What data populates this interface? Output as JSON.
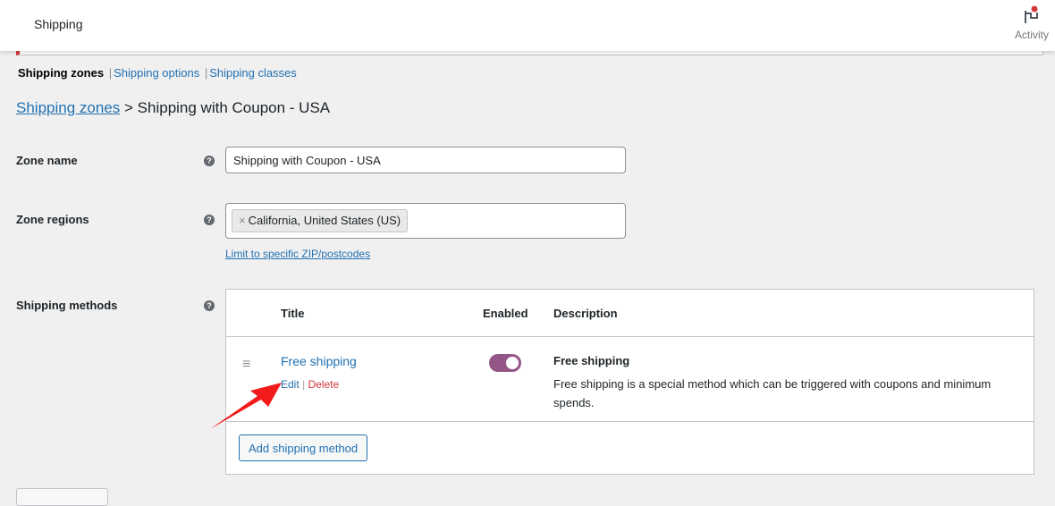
{
  "header": {
    "title": "Shipping",
    "activity_label": "Activity",
    "activity_icon": "flag-icon"
  },
  "subnav": {
    "items": [
      {
        "label": "Shipping zones",
        "active": true
      },
      {
        "label": "Shipping options"
      },
      {
        "label": "Shipping classes"
      }
    ],
    "separator": "|"
  },
  "breadcrumb": {
    "link": "Shipping zones",
    "separator": ">",
    "current": "Shipping with Coupon - USA"
  },
  "form": {
    "zone_name": {
      "label": "Zone name",
      "value": "Shipping with Coupon - USA"
    },
    "zone_regions": {
      "label": "Zone regions",
      "chips": [
        {
          "label": "California, United States (US)",
          "remove": "×"
        }
      ],
      "limit_link": "Limit to specific ZIP/postcodes"
    },
    "shipping_methods": {
      "label": "Shipping methods",
      "columns": [
        "Title",
        "Enabled",
        "Description"
      ],
      "rows": [
        {
          "title": "Free shipping",
          "edit": "Edit",
          "delete": "Delete",
          "enabled": true,
          "desc_title": "Free shipping",
          "desc_text": "Free shipping is a special method which can be triggered with coupons and minimum spends."
        }
      ],
      "add_button": "Add shipping method"
    },
    "help_glyph": "?"
  },
  "colors": {
    "link": "#2271b1",
    "toggle_on": "#935687",
    "delete": "#d63638",
    "annotation_arrow": "#f21a1a"
  }
}
